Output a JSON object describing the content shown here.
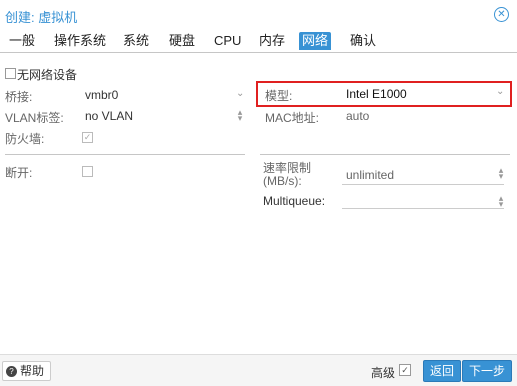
{
  "window": {
    "title": "创建: 虚拟机",
    "close_icon": "close-icon"
  },
  "tabs": [
    {
      "label": "一般"
    },
    {
      "label": "操作系统"
    },
    {
      "label": "系统"
    },
    {
      "label": "硬盘"
    },
    {
      "label": "CPU"
    },
    {
      "label": "内存"
    },
    {
      "label": "网络",
      "active": true
    },
    {
      "label": "确认"
    }
  ],
  "network": {
    "no_device_label": "无网络设备",
    "bridge_label": "桥接:",
    "bridge_value": "vmbr0",
    "vlan_label": "VLAN标签:",
    "vlan_value": "no VLAN",
    "firewall_label": "防火墙:",
    "firewall_checked": true,
    "model_label": "模型:",
    "model_value": "Intel E1000",
    "mac_label": "MAC地址:",
    "mac_value": "auto",
    "disconnect_label": "断开:",
    "disconnect_checked": false,
    "rate_label_line1": "速率限制",
    "rate_label_line2": "(MB/s):",
    "rate_value": "unlimited",
    "multiqueue_label": "Multiqueue:",
    "multiqueue_value": ""
  },
  "footer": {
    "help_label": "帮助",
    "advanced_label": "高级",
    "advanced_checked": true,
    "back_label": "返回",
    "next_label": "下一步"
  },
  "colors": {
    "accent": "#3892d4",
    "highlight": "#e02020"
  }
}
